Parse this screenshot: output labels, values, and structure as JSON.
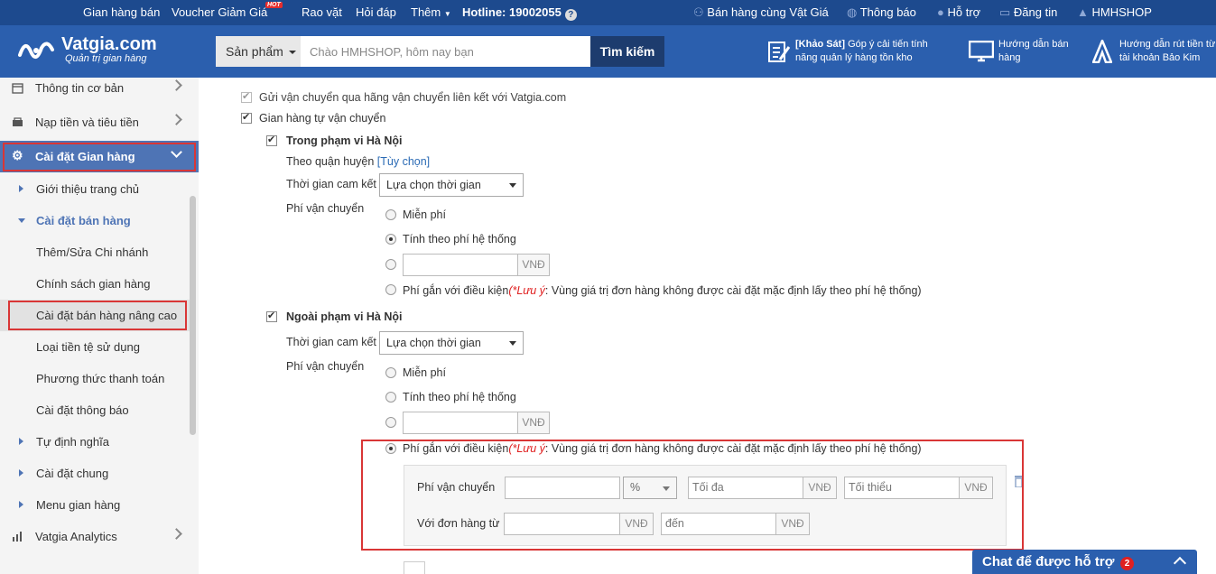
{
  "topbar": {
    "gian_hang_ban": "Gian hàng bán",
    "voucher": "Voucher Giảm Giá",
    "hot": "HOT",
    "rao_vat": "Rao vặt",
    "hoi_dap": "Hỏi đáp",
    "them": "Thêm",
    "hotline_label": "Hotline:",
    "hotline_number": "19002055",
    "ban_hang_cung": "Bán hàng cùng Vật Giá",
    "thong_bao": "Thông báo",
    "ho_tro": "Hỗ trợ",
    "dang_tin": "Đăng tin",
    "user": "HMHSHOP"
  },
  "header": {
    "logo_name": "Vatgia.com",
    "logo_sub": "Quản trị gian hàng",
    "search_category": "Sản phẩm",
    "search_placeholder": "Chào HMHSHOP, hôm nay bạn",
    "search_button": "Tìm kiếm",
    "survey_tag": "[Khảo Sát]",
    "survey_text": "Góp ý cải tiến tính",
    "survey_text2": "năng quản lý hàng tồn kho",
    "guide_sell_1": "Hướng dẫn bán",
    "guide_sell_2": "hàng",
    "guide_withdraw_1": "Hướng dẫn rút tiền từ",
    "guide_withdraw_2": "tài khoản Bảo Kim"
  },
  "sidebar": {
    "items": [
      {
        "label": "Thông tin cơ bản"
      },
      {
        "label": "Nạp tiền và tiêu tiền"
      },
      {
        "label": "Cài đặt Gian hàng"
      }
    ],
    "sub": [
      {
        "label": "Giới thiệu trang chủ"
      },
      {
        "label": "Cài đặt bán hàng"
      },
      {
        "label": "Thêm/Sửa Chi nhánh"
      },
      {
        "label": "Chính sách gian hàng"
      },
      {
        "label": "Cài đặt bán hàng nâng cao"
      },
      {
        "label": "Loại tiền tệ sử dụng"
      },
      {
        "label": "Phương thức thanh toán"
      },
      {
        "label": "Cài đặt thông báo"
      },
      {
        "label": "Tự định nghĩa"
      },
      {
        "label": "Cài đặt chung"
      },
      {
        "label": "Menu gian hàng"
      }
    ],
    "analytics": "Vatgia Analytics"
  },
  "main": {
    "ship_via_partner": "Gửi vận chuyển qua hãng vận chuyển liên kết với Vatgia.com",
    "self_ship": "Gian hàng tự vận chuyển",
    "in_hanoi": "Trong phạm vi Hà Nội",
    "by_district": "Theo quận huyện",
    "optional": "[Tùy chọn]",
    "commit_time": "Thời gian cam kết",
    "select_time": "Lựa chọn thời gian",
    "ship_fee": "Phí vận chuyển",
    "free": "Miễn phí",
    "by_system": "Tính theo phí hệ thống",
    "currency": "VNĐ",
    "conditional": "Phí gắn với điều kiện",
    "note_label": "(*Lưu ý",
    "note_text": ": Vùng giá trị đơn hàng không được cài đặt mặc định lấy theo phí hệ thống)",
    "out_hanoi": "Ngoài phạm vi Hà Nội",
    "cond_fee_label": "Phí vận chuyển",
    "percent": "%",
    "max_placeholder": "Tối đa",
    "min_placeholder": "Tối thiểu",
    "order_from": "Với đơn hàng từ",
    "to_placeholder": "đến"
  },
  "chat": {
    "label": "Chat để được hỗ trợ",
    "count": "2"
  },
  "colors": {
    "topbar": "#1d4a8e",
    "header": "#2b5fae",
    "active": "#4e74b5",
    "highlight": "#d93636"
  }
}
